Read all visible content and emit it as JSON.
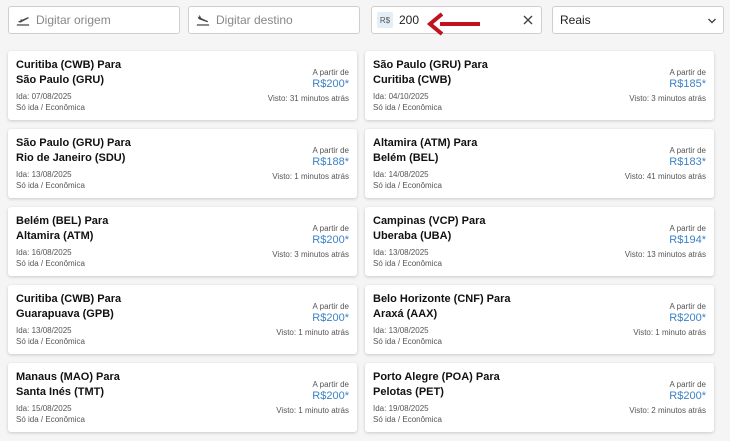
{
  "filters": {
    "origin_placeholder": "Digitar origem",
    "destination_placeholder": "Digitar destino",
    "price_currency_badge": "R$",
    "price_value": "200",
    "currency_value": "Reais"
  },
  "colors": {
    "price_link": "#3b83c6",
    "annotation_arrow": "#c1121f"
  },
  "cards": [
    {
      "route": "Curitiba (CWB) Para\nSão Paulo (GRU)",
      "date": "Ida: 07/08/2025",
      "type": "Só ida / Econômica",
      "from": "A partir de",
      "price": "R$200*",
      "seen": "Visto: 31 minutos atrás"
    },
    {
      "route": "São Paulo (GRU) Para\nCuritiba (CWB)",
      "date": "Ida: 04/10/2025",
      "type": "Só ida / Econômica",
      "from": "A partir de",
      "price": "R$185*",
      "seen": "Visto: 3 minutos atrás"
    },
    {
      "route": "São Paulo (GRU) Para\nRio de Janeiro (SDU)",
      "date": "Ida: 13/08/2025",
      "type": "Só ida / Econômica",
      "from": "A partir de",
      "price": "R$188*",
      "seen": "Visto: 1 minutos atrás"
    },
    {
      "route": "Altamira (ATM) Para\nBelém (BEL)",
      "date": "Ida: 14/08/2025",
      "type": "Só ida / Econômica",
      "from": "A partir de",
      "price": "R$183*",
      "seen": "Visto: 41 minutos atrás"
    },
    {
      "route": "Belém (BEL) Para\nAltamira (ATM)",
      "date": "Ida: 16/08/2025",
      "type": "Só ida / Econômica",
      "from": "A partir de",
      "price": "R$200*",
      "seen": "Visto: 3 minutos atrás"
    },
    {
      "route": "Campinas (VCP) Para\nUberaba (UBA)",
      "date": "Ida: 13/08/2025",
      "type": "Só ida / Econômica",
      "from": "A partir de",
      "price": "R$194*",
      "seen": "Visto: 13 minutos atrás"
    },
    {
      "route": "Curitiba (CWB) Para\nGuarapuava (GPB)",
      "date": "Ida: 13/08/2025",
      "type": "Só ida / Econômica",
      "from": "A partir de",
      "price": "R$200*",
      "seen": "Visto: 1 minuto atrás"
    },
    {
      "route": "Belo Horizonte (CNF) Para\nAraxá (AAX)",
      "date": "Ida: 13/08/2025",
      "type": "Só ida / Econômica",
      "from": "A partir de",
      "price": "R$200*",
      "seen": "Visto: 1 minuto atrás"
    },
    {
      "route": "Manaus (MAO) Para\nSanta Inés (TMT)",
      "date": "Ida: 15/08/2025",
      "type": "Só ida / Econômica",
      "from": "A partir de",
      "price": "R$200*",
      "seen": "Visto: 1 minuto atrás"
    },
    {
      "route": "Porto Alegre (POA) Para\nPelotas (PET)",
      "date": "Ida: 19/08/2025",
      "type": "Só ida / Econômica",
      "from": "A partir de",
      "price": "R$200*",
      "seen": "Visto: 2 minutos atrás"
    }
  ]
}
